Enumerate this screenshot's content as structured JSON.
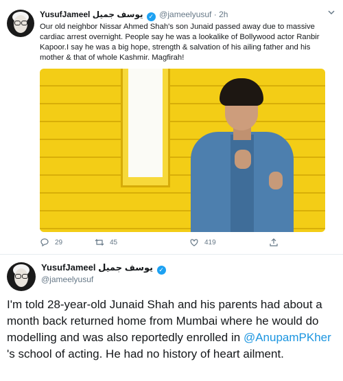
{
  "tweet1": {
    "author": {
      "name": "YusufJameel",
      "name_urdu": "یوسف جمیل",
      "handle": "@jameelyusuf",
      "time": "· 2h"
    },
    "text": "Our old neighbor Nissar Ahmed Shah's son Junaid passed away due to massive cardiac arrest overnight. People say he was a lookalike of Bollywood actor Ranbir Kapoor.I say he was a big hope, strength & salvation of his ailing father and his mother & that of whole Kashmir. Magfirah!",
    "actions": {
      "replies": "29",
      "retweets": "45",
      "likes": "419"
    }
  },
  "tweet2": {
    "author": {
      "name": "YusufJameel",
      "name_urdu": "یوسف جمیل",
      "handle": "@jameelyusuf"
    },
    "text_before": "I'm told 28-year-old Junaid Shah and his parents had about a month back returned home from Mumbai where he would do modelling and was also reportedly enrolled in ",
    "mention": "@AnupamPKher",
    "text_after": " 's school of acting. He had no history of heart ailment."
  },
  "colors": {
    "accent": "#1da1f2",
    "mention": "#1b95e0",
    "secondary_text": "#657786",
    "media_background": "#f3cd16"
  },
  "icons": [
    "verified-badge-icon",
    "chevron-down-icon",
    "reply-icon",
    "retweet-icon",
    "like-icon",
    "share-icon"
  ]
}
